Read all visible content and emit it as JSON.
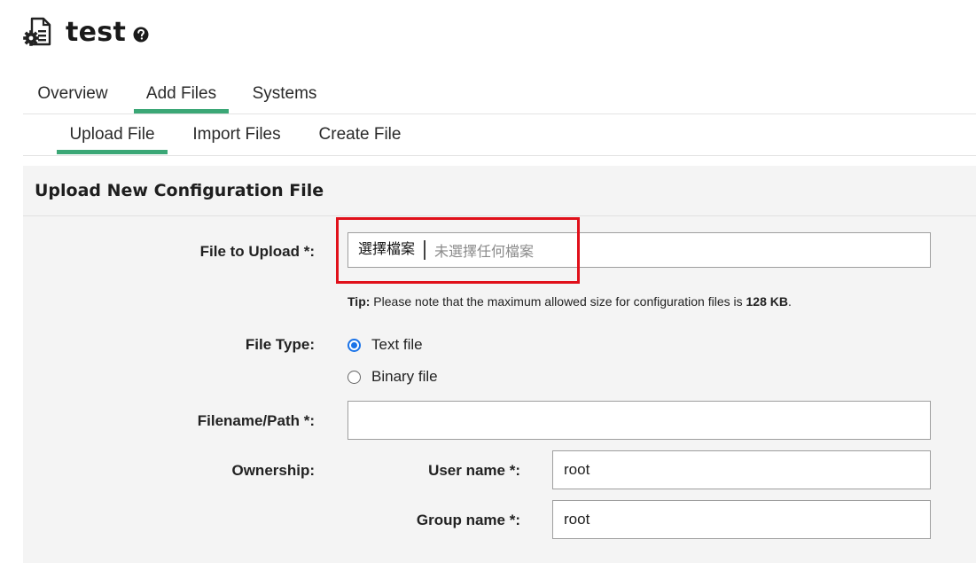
{
  "header": {
    "title": "test",
    "page_icon": "file-gear-icon",
    "help_icon": "question-circle-icon"
  },
  "tabs_primary": [
    {
      "label": "Overview",
      "active": false
    },
    {
      "label": "Add Files",
      "active": true
    },
    {
      "label": "Systems",
      "active": false
    }
  ],
  "tabs_secondary": [
    {
      "label": "Upload File",
      "active": true
    },
    {
      "label": "Import Files",
      "active": false
    },
    {
      "label": "Create File",
      "active": false
    }
  ],
  "panel": {
    "title": "Upload New Configuration File",
    "file_to_upload": {
      "label": "File to Upload *:",
      "choose_button": "選擇檔案",
      "status": "未選擇任何檔案"
    },
    "tip": {
      "prefix": "Tip:",
      "text": " Please note that the maximum allowed size for configuration files is ",
      "size": "128 KB",
      "suffix": "."
    },
    "file_type": {
      "label": "File Type:",
      "options": [
        {
          "label": "Text file",
          "selected": true
        },
        {
          "label": "Binary file",
          "selected": false
        }
      ]
    },
    "filename": {
      "label": "Filename/Path *:",
      "value": ""
    },
    "ownership": {
      "label": "Ownership:",
      "user_label": "User name *:",
      "user_value": "root",
      "group_label": "Group name *:",
      "group_value": "root"
    }
  },
  "colors": {
    "tab_active": "#3ba776",
    "highlight": "#e0101a",
    "radio": "#1a73e8"
  }
}
